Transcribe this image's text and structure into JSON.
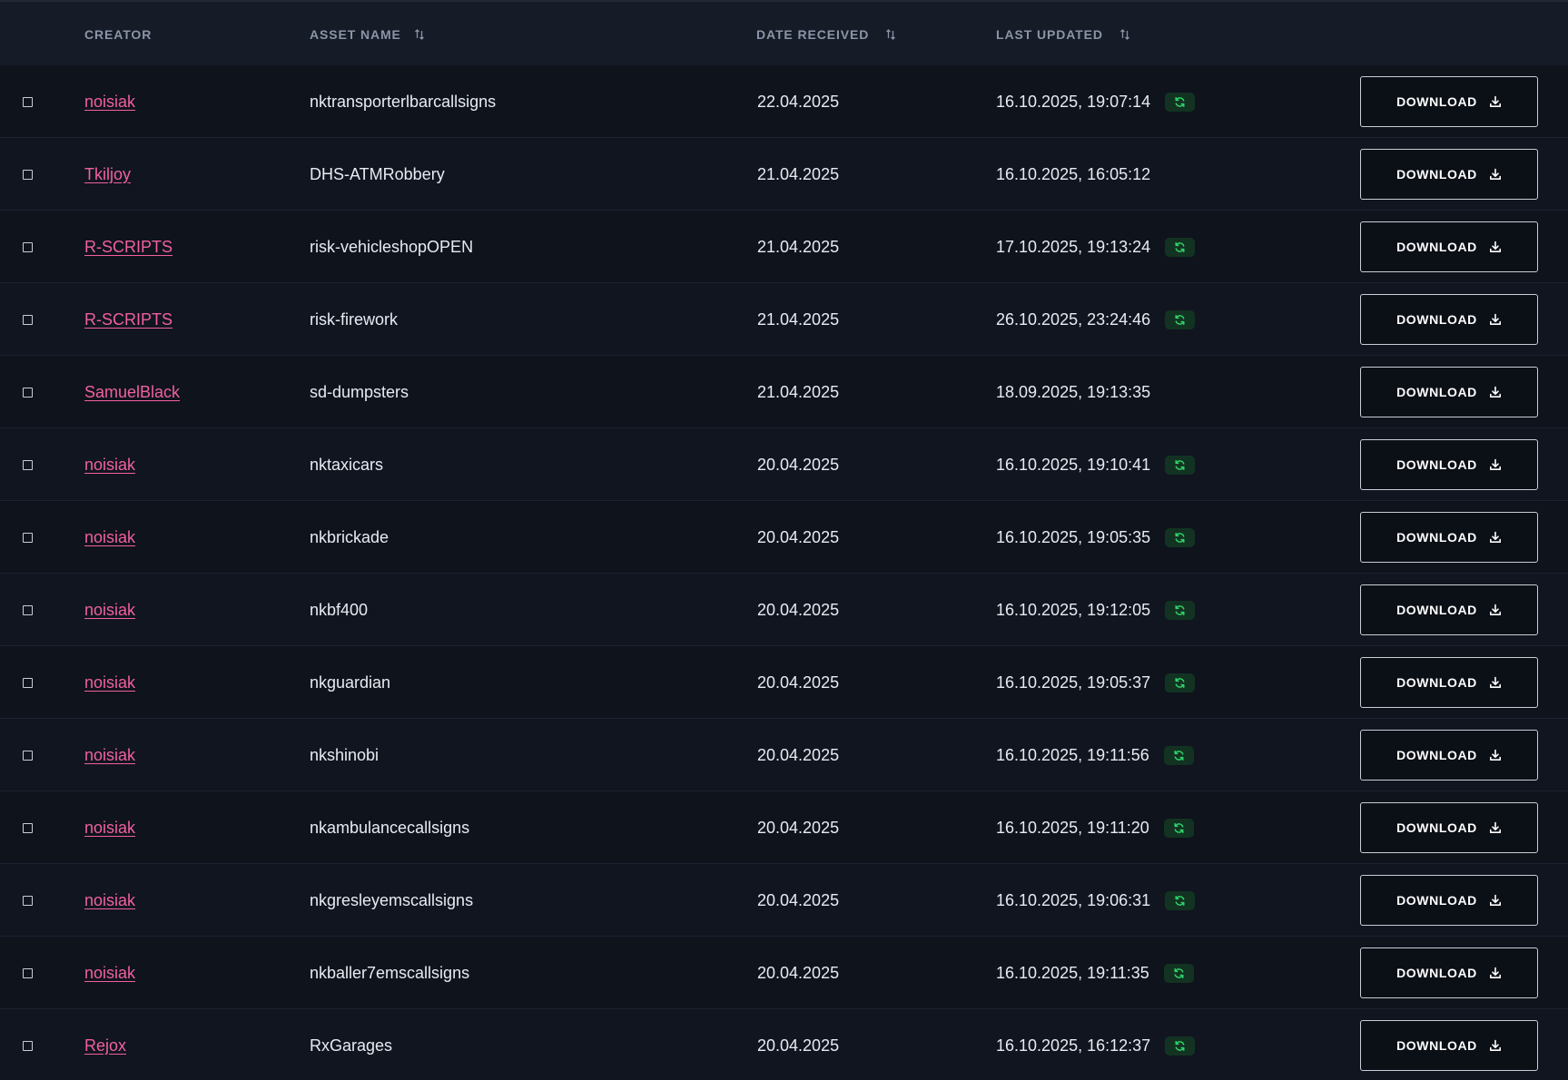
{
  "header": {
    "creator": "CREATOR",
    "asset_name": "ASSET NAME",
    "date_received": "DATE RECEIVED",
    "last_updated": "LAST UPDATED"
  },
  "download_label": "DOWNLOAD",
  "colors": {
    "creator_link": "#f0609f",
    "badge_bg": "#133322",
    "badge_icon": "#2fd46a"
  },
  "rows": [
    {
      "creator": "noisiak",
      "asset": "nktransporterlbarcallsigns",
      "received": "22.04.2025",
      "updated": "16.10.2025, 19:07:14",
      "has_update_badge": true
    },
    {
      "creator": "Tkiljoy",
      "asset": "DHS-ATMRobbery",
      "received": "21.04.2025",
      "updated": "16.10.2025, 16:05:12",
      "has_update_badge": false
    },
    {
      "creator": "R-SCRIPTS",
      "asset": "risk-vehicleshopOPEN",
      "received": "21.04.2025",
      "updated": "17.10.2025, 19:13:24",
      "has_update_badge": true
    },
    {
      "creator": "R-SCRIPTS",
      "asset": "risk-firework",
      "received": "21.04.2025",
      "updated": "26.10.2025, 23:24:46",
      "has_update_badge": true
    },
    {
      "creator": "SamuelBlack",
      "asset": "sd-dumpsters",
      "received": "21.04.2025",
      "updated": "18.09.2025, 19:13:35",
      "has_update_badge": false
    },
    {
      "creator": "noisiak",
      "asset": "nktaxicars",
      "received": "20.04.2025",
      "updated": "16.10.2025, 19:10:41",
      "has_update_badge": true
    },
    {
      "creator": "noisiak",
      "asset": "nkbrickade",
      "received": "20.04.2025",
      "updated": "16.10.2025, 19:05:35",
      "has_update_badge": true
    },
    {
      "creator": "noisiak",
      "asset": "nkbf400",
      "received": "20.04.2025",
      "updated": "16.10.2025, 19:12:05",
      "has_update_badge": true
    },
    {
      "creator": "noisiak",
      "asset": "nkguardian",
      "received": "20.04.2025",
      "updated": "16.10.2025, 19:05:37",
      "has_update_badge": true
    },
    {
      "creator": "noisiak",
      "asset": "nkshinobi",
      "received": "20.04.2025",
      "updated": "16.10.2025, 19:11:56",
      "has_update_badge": true
    },
    {
      "creator": "noisiak",
      "asset": "nkambulancecallsigns",
      "received": "20.04.2025",
      "updated": "16.10.2025, 19:11:20",
      "has_update_badge": true
    },
    {
      "creator": "noisiak",
      "asset": "nkgresleyemscallsigns",
      "received": "20.04.2025",
      "updated": "16.10.2025, 19:06:31",
      "has_update_badge": true
    },
    {
      "creator": "noisiak",
      "asset": "nkballer7emscallsigns",
      "received": "20.04.2025",
      "updated": "16.10.2025, 19:11:35",
      "has_update_badge": true
    },
    {
      "creator": "Rejox",
      "asset": "RxGarages",
      "received": "20.04.2025",
      "updated": "16.10.2025, 16:12:37",
      "has_update_badge": true
    }
  ]
}
